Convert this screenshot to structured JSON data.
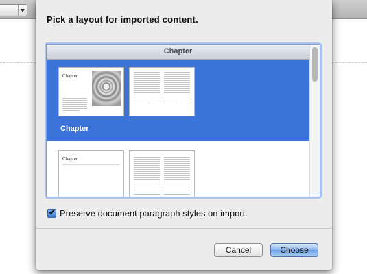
{
  "sheet": {
    "title": "Pick a layout for imported content.",
    "group_header": "Chapter",
    "layouts": [
      {
        "label": "Chapter",
        "thumb_title": "Chapter",
        "selected": true
      },
      {
        "label": "",
        "thumb_title": "Chapter",
        "selected": false
      }
    ],
    "preserve_label": "Preserve document paragraph styles on import.",
    "preserve_checked": true,
    "cancel_label": "Cancel",
    "choose_label": "Choose"
  },
  "colors": {
    "selection": "#3b73d8",
    "sheet_bg": "#ececec",
    "default_button": "#8cb5ee"
  }
}
